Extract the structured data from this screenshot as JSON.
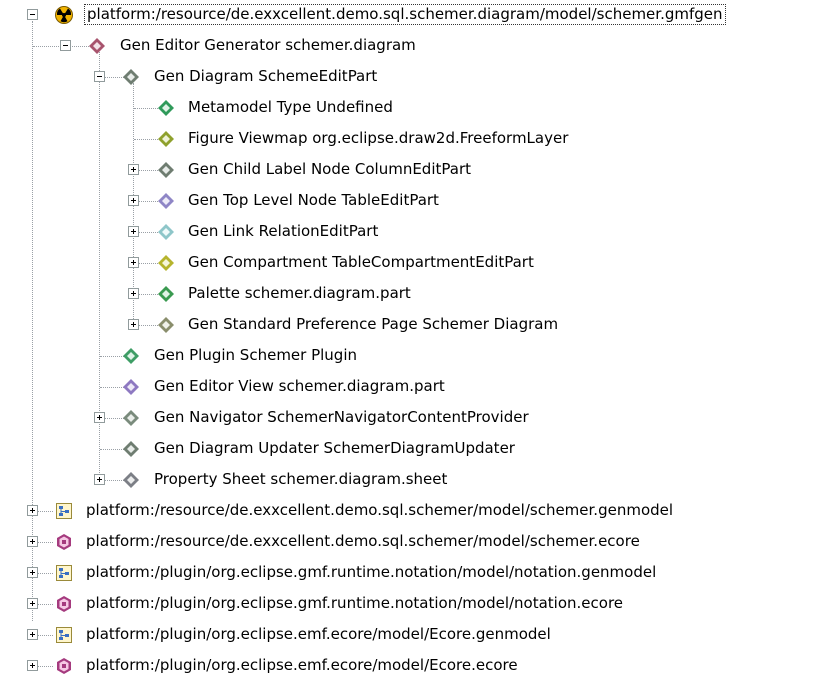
{
  "colors": {
    "gen_editor_generator": "#a8546d",
    "gen_diagram": "#6f7d71",
    "metamodel_type": "#2f9a5a",
    "figure_viewmap": "#8fa12d",
    "gen_child_label_node": "#6f7d71",
    "gen_top_level_node": "#8f86c6",
    "gen_link": "#8ec6c9",
    "gen_compartment": "#b6b42d",
    "palette": "#3a9a50",
    "gen_standard_preference_page": "#8a8e6c",
    "gen_plugin": "#3e9d65",
    "gen_editor_view": "#8e79c1",
    "gen_navigator": "#7a8b7c",
    "gen_diagram_updater": "#6f7d71",
    "property_sheet": "#7c7f86"
  },
  "tree": [
    {
      "label": "platform:/resource/de.exxcellent.demo.sql.schemer.diagram/model/schemer.gmfgen",
      "icon": "gmfgen-resource-icon",
      "toggle": "minus",
      "selected": true
    },
    {
      "label": "Gen Editor Generator schemer.diagram",
      "icon": "gen-editor-generator-icon",
      "toggle": "minus"
    },
    {
      "label": "Gen Diagram SchemeEditPart",
      "icon": "gen-diagram-icon",
      "toggle": "minus"
    },
    {
      "label": "Metamodel Type Undefined",
      "icon": "metamodel-type-icon"
    },
    {
      "label": "Figure Viewmap org.eclipse.draw2d.FreeformLayer",
      "icon": "figure-viewmap-icon"
    },
    {
      "label": "Gen Child Label Node ColumnEditPart",
      "icon": "gen-child-label-node-icon",
      "toggle": "plus"
    },
    {
      "label": "Gen Top Level Node TableEditPart",
      "icon": "gen-top-level-node-icon",
      "toggle": "plus"
    },
    {
      "label": "Gen Link RelationEditPart",
      "icon": "gen-link-icon",
      "toggle": "plus"
    },
    {
      "label": "Gen Compartment TableCompartmentEditPart",
      "icon": "gen-compartment-icon",
      "toggle": "plus"
    },
    {
      "label": "Palette schemer.diagram.part",
      "icon": "palette-icon",
      "toggle": "plus"
    },
    {
      "label": "Gen Standard Preference Page Schemer Diagram",
      "icon": "gen-standard-preference-page-icon",
      "toggle": "plus"
    },
    {
      "label": "Gen Plugin Schemer Plugin",
      "icon": "gen-plugin-icon"
    },
    {
      "label": "Gen Editor View schemer.diagram.part",
      "icon": "gen-editor-view-icon"
    },
    {
      "label": "Gen Navigator SchemerNavigatorContentProvider",
      "icon": "gen-navigator-icon",
      "toggle": "plus"
    },
    {
      "label": "Gen Diagram Updater SchemerDiagramUpdater",
      "icon": "gen-diagram-updater-icon"
    },
    {
      "label": "Property Sheet schemer.diagram.sheet",
      "icon": "property-sheet-icon",
      "toggle": "plus"
    },
    {
      "label": "platform:/resource/de.exxcellent.demo.sql.schemer/model/schemer.genmodel",
      "icon": "genmodel-resource-icon",
      "toggle": "plus"
    },
    {
      "label": "platform:/resource/de.exxcellent.demo.sql.schemer/model/schemer.ecore",
      "icon": "ecore-resource-icon",
      "toggle": "plus"
    },
    {
      "label": "platform:/plugin/org.eclipse.gmf.runtime.notation/model/notation.genmodel",
      "icon": "genmodel-resource-icon",
      "toggle": "plus"
    },
    {
      "label": "platform:/plugin/org.eclipse.gmf.runtime.notation/model/notation.ecore",
      "icon": "ecore-resource-icon",
      "toggle": "plus"
    },
    {
      "label": "platform:/plugin/org.eclipse.emf.ecore/model/Ecore.genmodel",
      "icon": "genmodel-resource-icon",
      "toggle": "plus"
    },
    {
      "label": "platform:/plugin/org.eclipse.emf.ecore/model/Ecore.ecore",
      "icon": "ecore-resource-icon",
      "toggle": "plus"
    }
  ]
}
